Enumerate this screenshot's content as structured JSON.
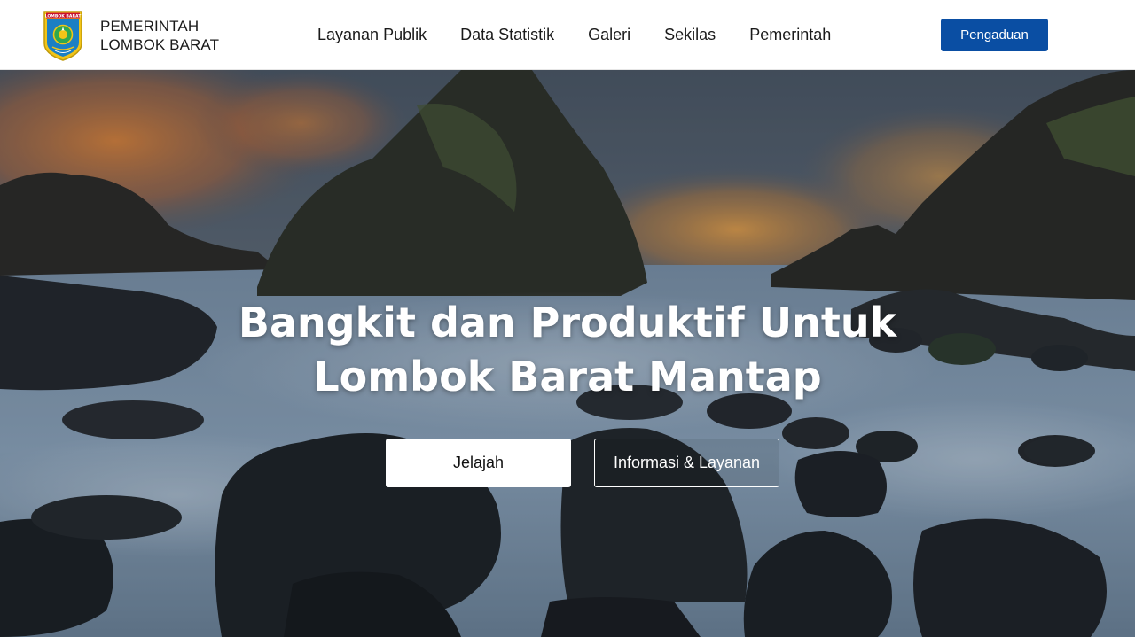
{
  "brand": {
    "line1": "PEMERINTAH",
    "line2": "LOMBOK BARAT",
    "logo_text": "LOMBOK BARAT",
    "logo_icon": "lombok-barat-emblem"
  },
  "nav": {
    "items": [
      {
        "label": "Layanan Publik"
      },
      {
        "label": "Data Statistik"
      },
      {
        "label": "Galeri"
      },
      {
        "label": "Sekilas"
      },
      {
        "label": "Pemerintah"
      }
    ]
  },
  "header": {
    "cta_label": "Pengaduan"
  },
  "hero": {
    "title_line1": "Bangkit dan Produktif Untuk",
    "title_line2": "Lombok Barat Mantap",
    "primary_button": "Jelajah",
    "secondary_button": "Informasi & Layanan",
    "background": "coastal-rocks-sunset-photo"
  },
  "colors": {
    "accent": "#0a4ea3",
    "header_bg": "#ffffff",
    "text_dark": "#1a1a1a",
    "hero_text": "#ffffff"
  }
}
